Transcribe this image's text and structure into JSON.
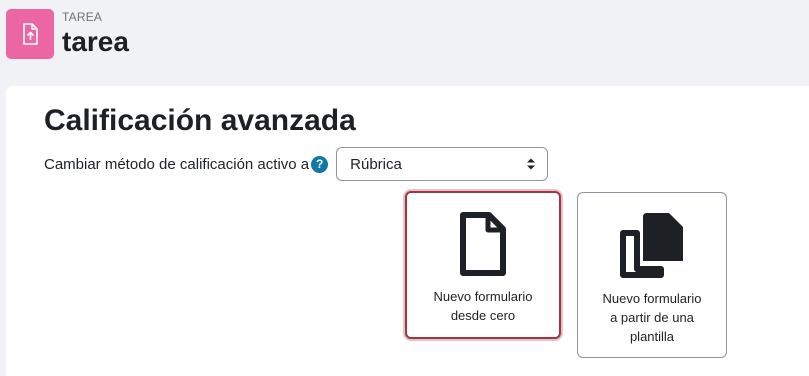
{
  "header": {
    "pretitle": "TAREA",
    "title": "tarea",
    "icon": "assignment-upload-icon",
    "icon_color": "#eb66a2"
  },
  "main": {
    "title": "Calificación avanzada",
    "method_label": "Cambiar método de calificación activo a",
    "help_icon": "question-icon",
    "method_select": {
      "value": "Rúbrica"
    },
    "options": [
      {
        "label_line1": "Nuevo formulario",
        "label_line2": "desde cero",
        "icon": "blank-document-icon"
      },
      {
        "label_line1": "Nuevo formulario",
        "label_line2": "a partir de una",
        "label_line3": "plantilla",
        "icon": "copy-documents-icon"
      }
    ]
  },
  "colors": {
    "accent": "#1177a3",
    "focus_border": "#9d3743",
    "text": "#1d2125"
  }
}
